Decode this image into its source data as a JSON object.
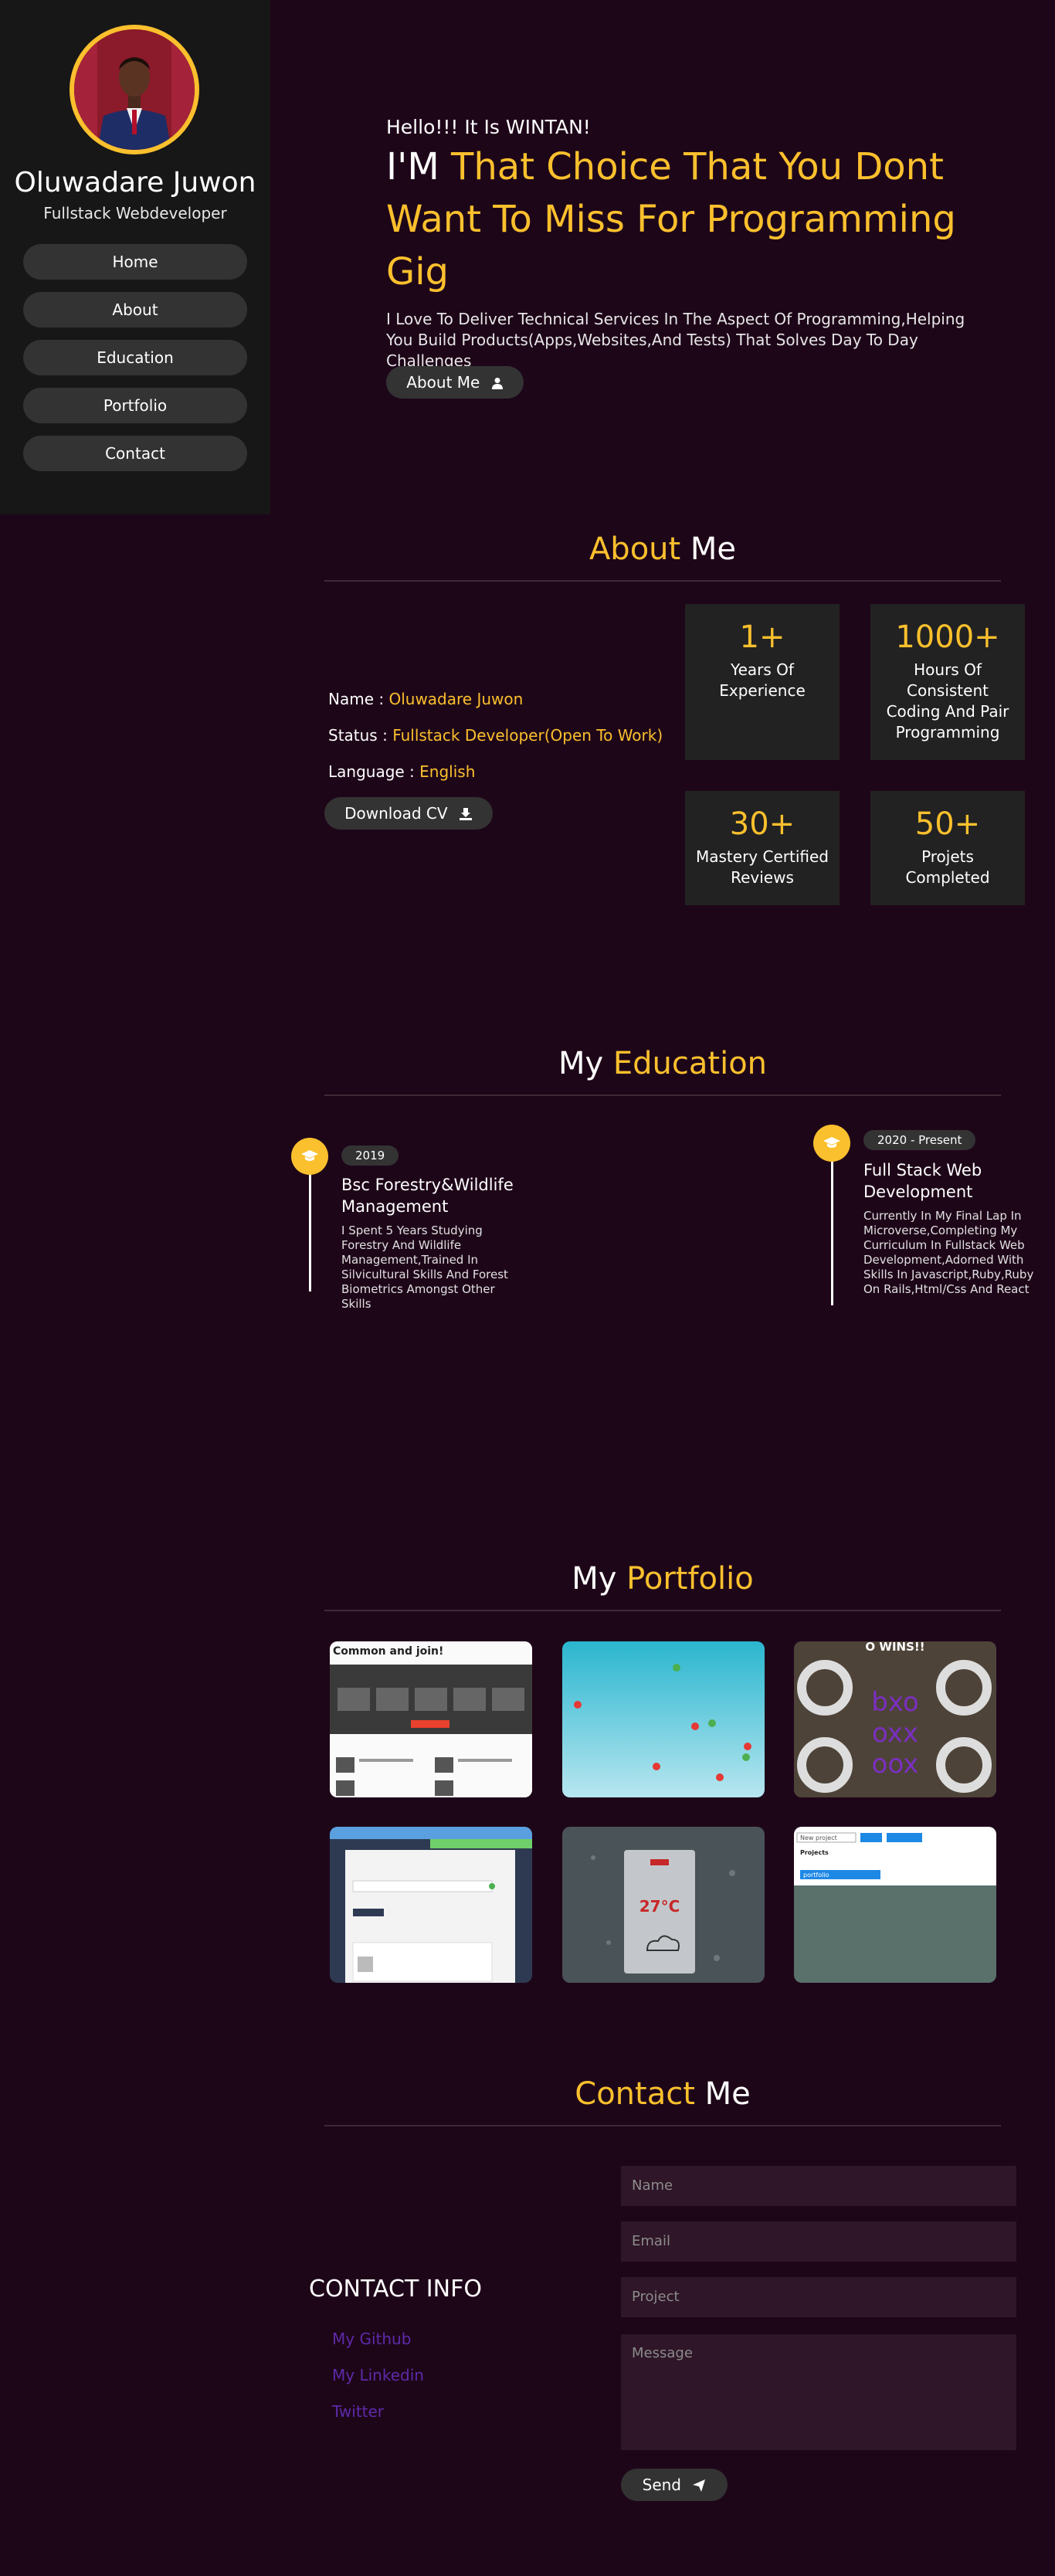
{
  "sidebar": {
    "name": "Oluwadare Juwon",
    "role": "Fullstack Webdeveloper",
    "nav": [
      "Home",
      "About",
      "Education",
      "Portfolio",
      "Contact"
    ]
  },
  "hero": {
    "hello": "Hello!!! It Is WINTAN!",
    "im": "I'M",
    "headline": "That Choice That You Dont Want To Miss For Programming Gig",
    "intro": "I Love To Deliver Technical Services In The Aspect Of Programming,Helping You Build Products(Apps,Websites,And Tests) That Solves Day To Day Challenges",
    "button": "About Me"
  },
  "about": {
    "title_a": "About",
    "title_b": "Me",
    "name_label": "Name :",
    "name_value": "Oluwadare Juwon",
    "status_label": "Status :",
    "status_value": "Fullstack Developer(Open To Work)",
    "language_label": "Language :",
    "language_value": "English",
    "cv_button": "Download CV",
    "stats": [
      {
        "num": "1+",
        "label": "Years Of Experience"
      },
      {
        "num": "1000+",
        "label": "Hours Of Consistent Coding And Pair Programming"
      },
      {
        "num": "30+",
        "label": "Mastery Certified Reviews"
      },
      {
        "num": "50+",
        "label": "Projets Completed"
      }
    ]
  },
  "education": {
    "title_a": "My",
    "title_b": "Education",
    "items": [
      {
        "year": "2019",
        "title": "Bsc Forestry&Wildlife Management",
        "text": "I Spent 5 Years Studying Forestry And Wildlife Management,Trained In Silvicultural Skills And Forest Biometrics Amongst Other Skills"
      },
      {
        "year": "2020 - Present",
        "title": "Full Stack Web Development",
        "text": "Currently In My Final Lap In Microverse,Completing My Curriculum In Fullstack Web Development,Adorned With Skills In Javascript,Ruby,Ruby On Rails,Html/Css And React"
      }
    ]
  },
  "portfolio": {
    "title_a": "My",
    "title_b": "Portfolio",
    "thumbs": {
      "t1_title": "Common and join!",
      "t3_title": "O WINS!!",
      "t6_search": "New project",
      "t6_label": "Projects",
      "t6_item": "portfolio",
      "t5_temp": "27°C"
    }
  },
  "contact": {
    "title_a": "Contact",
    "title_b": "Me",
    "info_title": "CONTACT INFO",
    "links": [
      "My Github",
      "My Linkedin",
      "Twitter"
    ],
    "name_placeholder": "Name",
    "email_placeholder": "Email",
    "project_placeholder": "Project",
    "message_placeholder": "Message",
    "send": "Send"
  },
  "colors": {
    "accent": "#fbc02d",
    "background": "#1e0619",
    "sidebar": "#171717",
    "link": "#5d2aa8"
  }
}
